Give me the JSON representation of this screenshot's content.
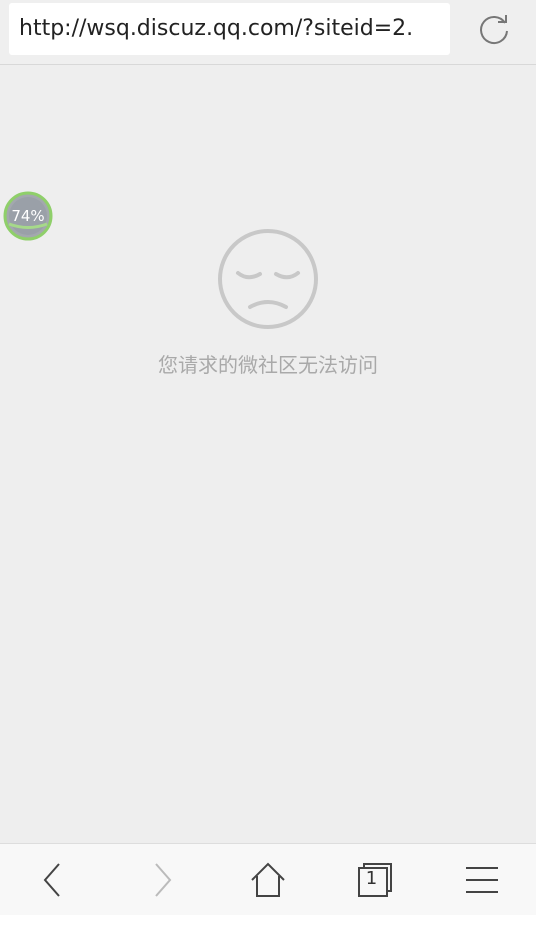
{
  "browser": {
    "url": "http://wsq.discuz.qq.com/?siteid=2.",
    "reload_icon": "reload-icon"
  },
  "page": {
    "error_icon": "sad-face-icon",
    "error_message": "您请求的微社区无法访问"
  },
  "progress": {
    "label": "74%",
    "value": 0.74
  },
  "toolbar": {
    "back_icon": "chevron-left-icon",
    "forward_icon": "chevron-right-icon",
    "home_icon": "home-icon",
    "tabs_icon": "tabs-icon",
    "tabs_count": "1",
    "menu_icon": "menu-icon"
  },
  "colors": {
    "background": "#eeeeee",
    "progress_ring": "#8fcf6a",
    "progress_fill": "#9aa0a8",
    "icon_gray": "#c8c8c8"
  }
}
